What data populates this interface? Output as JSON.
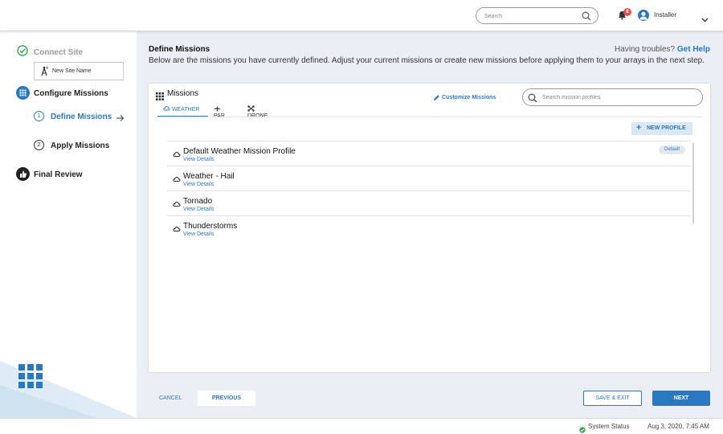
{
  "header": {
    "search_placeholder": "Search",
    "notification_count": "8",
    "user_name": "Installer"
  },
  "sidebar": {
    "connect_site": "Connect Site",
    "site_name": "New Site Name",
    "configure_missions": "Configure Missions",
    "define_missions_num": "1",
    "define_missions": "Define Missions",
    "apply_missions_num": "2",
    "apply_missions": "Apply Missions",
    "final_review": "Final Review"
  },
  "main": {
    "title": "Define Missions",
    "description": "Below are the missions you have currently defined. Adjust your current missions or create new missions before applying them to your arrays in the next step.",
    "trouble_text": "Having troubles?",
    "help_link": "Get Help",
    "card": {
      "title": "Missions",
      "customize": "Customize Missions",
      "search_placeholder": "Search mission profiles",
      "tabs": [
        {
          "label": "WEATHER",
          "icon": "cloud-icon",
          "active": true
        },
        {
          "label": "PAR",
          "icon": "airplane-icon",
          "active": false
        },
        {
          "label": "DRONE",
          "icon": "drone-icon",
          "active": false
        }
      ],
      "new_profile": "NEW PROFILE",
      "missions": [
        {
          "name": "Default Weather Mission Profile",
          "link": "View Details",
          "badge": "Default"
        },
        {
          "name": "Weather - Hail",
          "link": "View Details"
        },
        {
          "name": "Tornado",
          "link": "View Details"
        },
        {
          "name": "Thunderstorms",
          "link": "View Details"
        }
      ]
    },
    "buttons": {
      "cancel": "CANCEL",
      "previous": "PREVIOUS",
      "save_exit": "SAVE & EXIT",
      "next": "NEXT"
    }
  },
  "footer": {
    "system_status": "System Status",
    "timestamp": "Aug 3, 2020,  7:45 AM"
  },
  "colors": {
    "accent": "#2b78c2",
    "background": "#eceef5",
    "status_ok": "#3aa757",
    "alert": "#d9534f"
  }
}
